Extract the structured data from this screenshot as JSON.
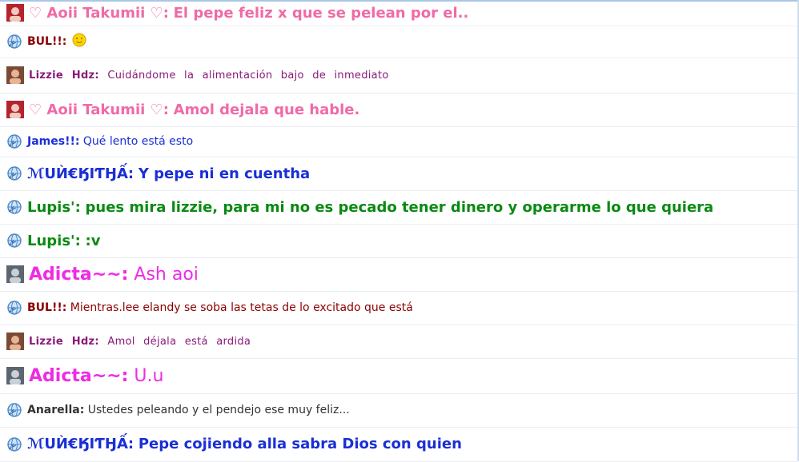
{
  "messages": [
    {
      "avatar": "girl-photo-avatar-icon",
      "name": "♡ Aoii Takumii ♡:",
      "text": "El pepe feliz x que se pelean por el..",
      "color": "#f06aa7",
      "size": "l",
      "bold": true
    },
    {
      "avatar": "globe-arrow-icon",
      "name": "BUL!!:",
      "text": "",
      "color": "#8b0000",
      "size": "m",
      "bold": false,
      "emoji": "yellow-smiley-emoji-icon"
    },
    {
      "avatar": "photo-avatar-icon",
      "name": "Lizzie Hdz:",
      "text": "Cuidándome la alimentación bajo de inmediato",
      "color": "#8a1a78",
      "size": "s",
      "bold": false,
      "wide": true
    },
    {
      "avatar": "girl-photo-avatar-icon",
      "name": "♡ Aoii Takumii ♡:",
      "text": "Amol dejala que hable.",
      "color": "#f06aa7",
      "size": "l",
      "bold": true
    },
    {
      "avatar": "globe-arrow-icon",
      "name": "James!!:",
      "text": "Qué lento está esto",
      "color": "#1a2fd6",
      "size": "m",
      "bold": false
    },
    {
      "avatar": "globe-arrow-icon",
      "name": "ℳUЍ€ӃIƬӇẤ:",
      "text": "Y pepe ni en cuentha",
      "color": "#1a2fd6",
      "size": "l",
      "bold": true
    },
    {
      "avatar": "globe-arrow-icon",
      "name": "Lupis':",
      "text": "pues mira lizzie, para mi no es pecado tener dinero y operarme lo que quiera",
      "color": "#0a8a12",
      "size": "l",
      "bold": true
    },
    {
      "avatar": "globe-arrow-icon",
      "name": "Lupis':",
      "text": ":v",
      "color": "#0a8a12",
      "size": "l",
      "bold": true
    },
    {
      "avatar": "grey-photo-avatar-icon",
      "name": "Adicta~~:",
      "text": "Ash aoi",
      "color": "#ef2be6",
      "size": "xl",
      "bold": false
    },
    {
      "avatar": "globe-arrow-icon",
      "name": "BUL!!:",
      "text": "Mientras.lee elandy se soba las tetas de lo excitado que está",
      "color": "#8b0000",
      "size": "m",
      "bold": false
    },
    {
      "avatar": "photo-avatar-icon",
      "name": "Lizzie Hdz:",
      "text": "Amol déjala está ardida",
      "color": "#8a1a78",
      "size": "s",
      "bold": false,
      "wide": true
    },
    {
      "avatar": "grey-photo-avatar-icon",
      "name": "Adicta~~:",
      "text": "U.u",
      "color": "#ef2be6",
      "size": "xl",
      "bold": false
    },
    {
      "avatar": "globe-arrow-icon",
      "name": "Anarella:",
      "text": "Ustedes peleando y el pendejo ese muy feliz...",
      "color": "#333333",
      "size": "m",
      "bold": false
    },
    {
      "avatar": "globe-arrow-icon",
      "name": "ℳUЍ€ӃIƬӇẤ:",
      "text": "Pepe cojiendo alla sabra Dios con quien",
      "color": "#1a2fd6",
      "size": "l",
      "bold": true
    }
  ]
}
